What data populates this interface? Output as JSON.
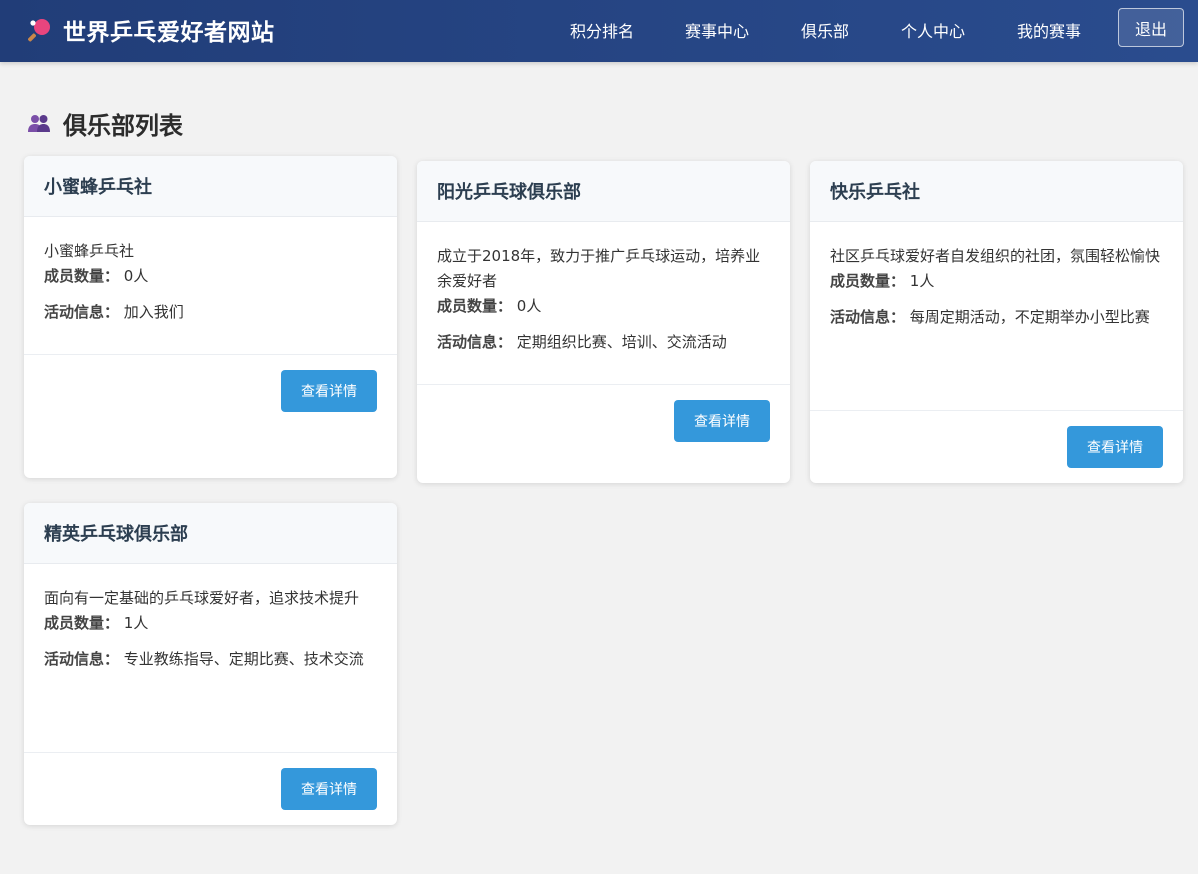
{
  "site": {
    "title": "世界乒乓爱好者网站"
  },
  "nav": {
    "items": [
      {
        "label": "积分排名"
      },
      {
        "label": "赛事中心"
      },
      {
        "label": "俱乐部"
      },
      {
        "label": "个人中心"
      },
      {
        "label": "我的赛事"
      }
    ],
    "logout_label": "退出"
  },
  "page": {
    "heading": "俱乐部列表"
  },
  "labels": {
    "members": "成员数量：",
    "activity": "活动信息：",
    "detail_button": "查看详情"
  },
  "clubs": [
    {
      "name": "小蜜蜂乒乓社",
      "description": "小蜜蜂乒乓社",
      "members": "0人",
      "activity": "加入我们"
    },
    {
      "name": "阳光乒乓球俱乐部",
      "description": "成立于2018年，致力于推广乒乓球运动，培养业余爱好者",
      "members": "0人",
      "activity": "定期组织比赛、培训、交流活动"
    },
    {
      "name": "快乐乒乓社",
      "description": "社区乒乓球爱好者自发组织的社团，氛围轻松愉快",
      "members": "1人",
      "activity": "每周定期活动，不定期举办小型比赛"
    },
    {
      "name": "精英乒乓球俱乐部",
      "description": "面向有一定基础的乒乓球爱好者，追求技术提升",
      "members": "1人",
      "activity": "专业教练指导、定期比赛、技术交流"
    }
  ],
  "colors": {
    "header_bg": "#213d78",
    "button_bg": "#3498db",
    "page_bg": "#f2f2f2"
  }
}
